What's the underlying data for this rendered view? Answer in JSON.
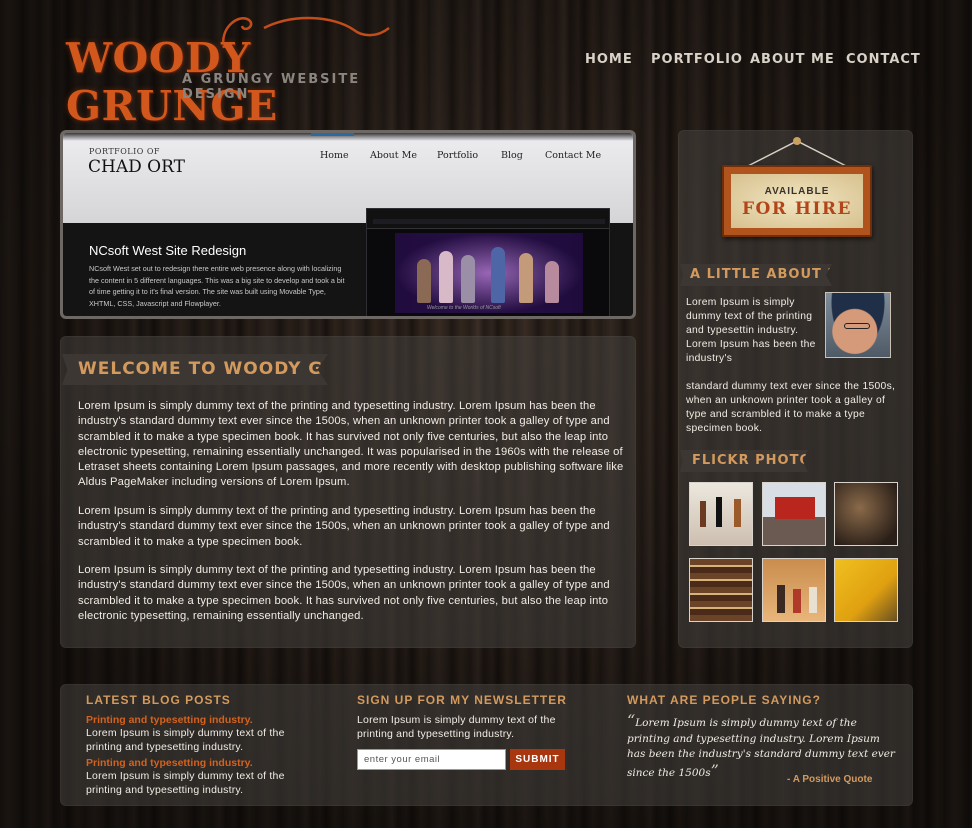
{
  "logo": {
    "title": "WOODY GRUNGE",
    "subtitle": "A GRUNGY WEBSITE DESIGN"
  },
  "nav": [
    {
      "label": "HOME"
    },
    {
      "label": "PORTFOLIO"
    },
    {
      "label": "ABOUT ME"
    },
    {
      "label": "CONTACT"
    }
  ],
  "showcase": {
    "portfolio_of": "PORTFOLIO OF",
    "name": "CHAD ORT",
    "nav": [
      "Home",
      "About Me",
      "Portfolio",
      "Blog",
      "Contact Me"
    ],
    "project_title": "NCsoft West Site Redesign",
    "project_body": "NCsoft West set out to redesign there entire web presence along with localizing the content in 5 different languages. This was a big site to develop and took a bit of time getting it to it's final version. The site was built using Movable Type, XHTML, CSS, Javascript and Flowplayer.",
    "screenshot_caption": "Welcome to the Worlds of NCsoft"
  },
  "welcome": {
    "title": "WELCOME TO WOODY GRUNGE",
    "paragraphs": [
      "Lorem Ipsum is simply dummy text of the printing and typesetting industry. Lorem Ipsum has been the industry's standard dummy text ever since the 1500s, when an unknown printer took a galley of type and scrambled it to make a type specimen book. It has survived not only five centuries, but also the leap into electronic typesetting, remaining essentially unchanged. It was popularised in the 1960s with the release of Letraset sheets containing Lorem Ipsum passages, and more recently with desktop publishing software like Aldus PageMaker including versions of Lorem Ipsum.",
      "Lorem Ipsum is simply dummy text of the printing and typesetting industry. Lorem Ipsum has been the industry's standard dummy text ever since the 1500s, when an unknown printer took a galley of type and scrambled it to make a type specimen book.",
      "Lorem Ipsum is simply dummy text of the printing and typesetting industry. Lorem Ipsum has been the industry's standard dummy text ever since the 1500s, when an unknown printer took a galley of type and scrambled it to make a type specimen book. It has survived not only five centuries, but also the leap into electronic typesetting, remaining essentially unchanged."
    ]
  },
  "sidebar": {
    "sign_line1": "AVAILABLE",
    "sign_line2": "FOR HIRE",
    "about_title": "A LITTLE ABOUT ME",
    "about_text_a": "Lorem Ipsum is simply dummy text of the printing and typesettin industry. Lorem Ipsum has been the industry's",
    "about_text_b": "standard dummy text ever since the 1500s, when an unknown printer took a galley of type and scrambled it to make a type specimen book.",
    "flickr_title": "FLICKR PHOTOS"
  },
  "footer": {
    "blog_title": "LATEST BLOG POSTS",
    "posts": [
      {
        "title": "Printing and typesetting industry.",
        "excerpt": "Lorem Ipsum is simply dummy text of the printing and typesetting industry."
      },
      {
        "title": "Printing and typesetting industry.",
        "excerpt": "Lorem Ipsum is simply dummy text of the printing and typesetting industry."
      }
    ],
    "newsletter_title": "SIGN UP FOR MY NEWSLETTER",
    "newsletter_text": "Lorem Ipsum is simply dummy text of the printing and typesetting industry.",
    "email_placeholder": "enter your email",
    "submit_label": "SUBMIT",
    "quote_title": "WHAT ARE PEOPLE SAYING?",
    "quote_open": "“",
    "quote": "Lorem Ipsum is simply dummy text of the printing and typesetting industry. Lorem Ipsum has been the industry's standard dummy text ever since the 1500s",
    "quote_close": "”",
    "quote_author": "- A Positive Quote"
  },
  "colors": {
    "accent_orange": "#d4621e",
    "heading_tan": "#d39a5e",
    "submit_bg": "#a8360f"
  }
}
